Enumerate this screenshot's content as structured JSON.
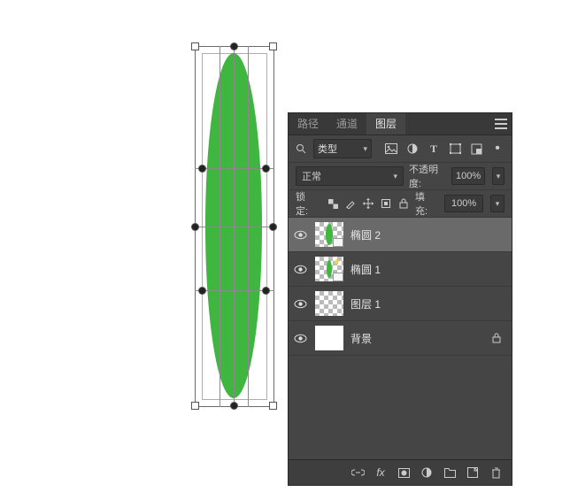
{
  "colors": {
    "leaf": "#3fb63f",
    "panel_bg": "#454545"
  },
  "tabs": {
    "paths": "路径",
    "channels": "通道",
    "layers": "图层"
  },
  "filter": {
    "search_icon": "search-icon",
    "type_label": "类型",
    "icons": [
      "image-icon",
      "adjust-icon",
      "text-icon",
      "shape-icon",
      "smartobj-icon",
      "artboard-dot-icon"
    ]
  },
  "blend": {
    "mode_label": "正常",
    "opacity_label": "不透明度:",
    "opacity_value": "100%",
    "lock_label": "锁定:",
    "fill_label": "填充:",
    "fill_value": "100%",
    "lock_icons": [
      "lock-pixels-icon",
      "lock-paint-icon",
      "lock-position-icon",
      "lock-artboard-icon",
      "lock-all-icon"
    ]
  },
  "layers": [
    {
      "visible": true,
      "name": "椭圆 2",
      "thumb": "shape",
      "selected": true,
      "locked": false
    },
    {
      "visible": true,
      "name": "椭圆 1",
      "thumb": "shape-star",
      "selected": false,
      "locked": false
    },
    {
      "visible": true,
      "name": "图层 1",
      "thumb": "checker",
      "selected": false,
      "locked": false
    },
    {
      "visible": true,
      "name": "背景",
      "thumb": "bg",
      "selected": false,
      "locked": true
    }
  ],
  "bottom_icons": [
    "link-icon",
    "fx-icon",
    "mask-icon",
    "adjustment-icon",
    "group-icon",
    "new-layer-icon",
    "trash-icon"
  ]
}
